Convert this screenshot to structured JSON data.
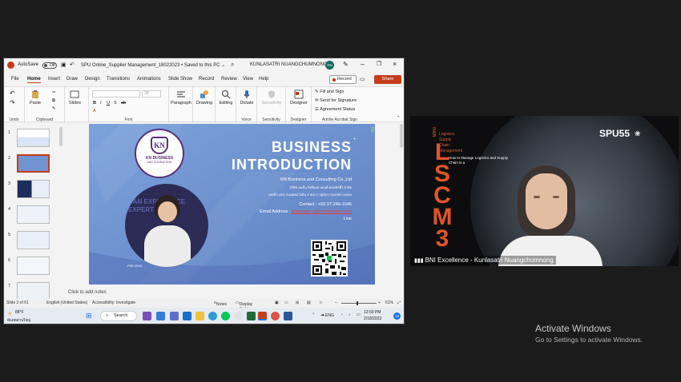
{
  "window": {
    "autosave_label": "AutoSave",
    "autosave_state": "Off",
    "doc_title": "SPU Online_Supplier Management_18022023 • Saved to this PC ⌄",
    "user_name": "KUNLASATRI NUANGCHUMNONG",
    "user_initials": "KN"
  },
  "tabs": [
    "File",
    "Home",
    "Insert",
    "Draw",
    "Design",
    "Transitions",
    "Animations",
    "Slide Show",
    "Record",
    "Review",
    "View",
    "Help"
  ],
  "active_tab": "Home",
  "record_label": "Record",
  "share_label": "Share",
  "ribbon": {
    "undo": "Undo",
    "paste": "Paste",
    "clipboard": "Clipboard",
    "slides": "Slides",
    "font": "Font",
    "font_size": "28",
    "paragraph": "Paragraph",
    "drawing": "Drawing",
    "editing": "Editing",
    "dictate": "Dictate",
    "voice": "Voice",
    "sensitivity": "Sensitivity",
    "designer": "Designer",
    "fill_and_sign": "Fill and Sign",
    "send_for_signature": "Send for Signature",
    "agreement_status": "Agreement Status",
    "adobe_group": "Adobe Acrobat Sign"
  },
  "thumbnail_numbers": [
    "1",
    "2",
    "3",
    "4",
    "5",
    "6",
    "7"
  ],
  "slide": {
    "logo_line1": "KN BUSINESS",
    "logo_line2": "AND CONSULTING",
    "title_line1": "BUSINESS",
    "title_line2": "INTRODUCTION",
    "company": "KN Business and Consulting Co.,Ltd",
    "company_th": "บริษัท เคเอ็น บิสซิเนส แอนด์ คอนซัลติ้ง จำกัด",
    "address_th": "เลขที่ 1/203 ถนนพหลโยธิน ลาดยาว จตุจักร กรุงเทพฯ 10900",
    "contact": "Contact : +66 97-246-1545",
    "email_label": "Email Address :",
    "email_value": "kunlasatri.n@kn-business.com",
    "line": "Line",
    "date": "FEB 2023",
    "photo_text": "DAN EXPERIENCE EXPERT TAKE"
  },
  "notes_placeholder": "Click to add notes",
  "status": {
    "slide_pos": "Slide 2 of 61",
    "language": "English (United States)",
    "accessibility": "Accessibility: Investigate",
    "notes": "Notes",
    "display": "Display Settings",
    "zoom": "61%"
  },
  "taskbar": {
    "temp": "88°F",
    "weather": "มีแดดส่วนใหญ่",
    "search": "Search",
    "lang": "ENG",
    "time": "12:59 PM",
    "date": "2/18/2023",
    "badge": "12"
  },
  "video": {
    "participant": "BNI Excellence - Kunlasatri Nuangchumnong",
    "backdrop_word": "LSCM3",
    "backdrop_small": "MINI",
    "backdrop_lines": [
      "Logistics",
      "Supply",
      "Chain",
      "Management"
    ],
    "backdrop_subtitle": "How to Manage Logistics and Supply Chain in a",
    "brand": "SPU55"
  },
  "activate": {
    "title": "Activate Windows",
    "subtitle": "Go to Settings to activate Windows."
  }
}
